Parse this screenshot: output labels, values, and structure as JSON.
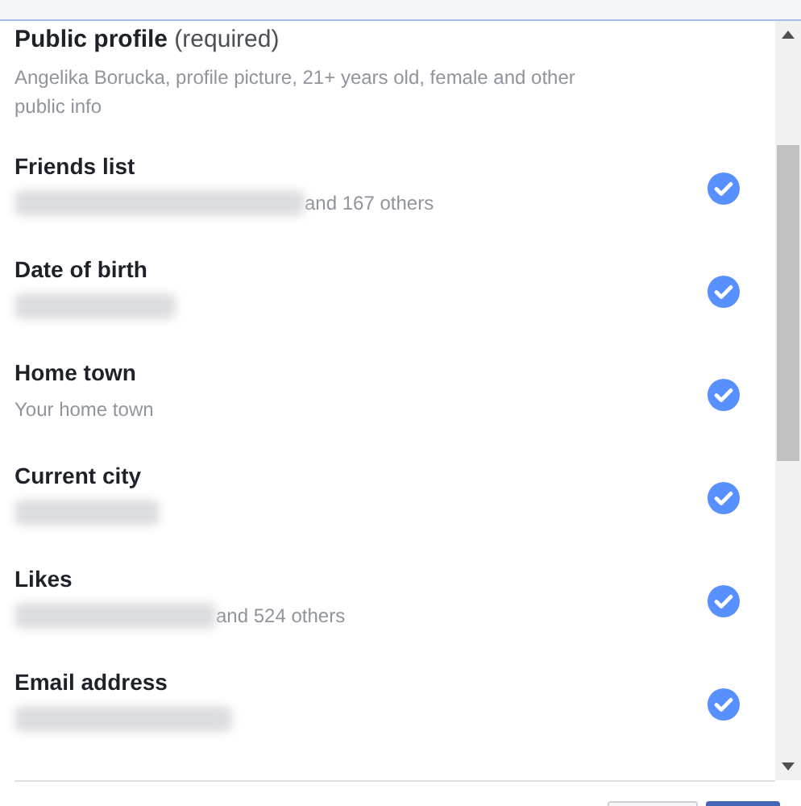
{
  "header": {
    "title": "**Public profile** (required)",
    "detail": "Angelika Borucka, profile picture, 21+ years old, female and other public info"
  },
  "permissions": [
    {
      "label": "Friends list",
      "redacted": true,
      "detail": "and 167 others",
      "checked": true
    },
    {
      "label": "Date of birth",
      "redacted": true,
      "checked": true
    },
    {
      "label": "Home town",
      "redacted": false,
      "detail": "Your home town",
      "checked": true
    },
    {
      "label": "Current city",
      "redacted": true,
      "checked": true
    },
    {
      "label": "Likes",
      "redacted": true,
      "detail": "and 524 others",
      "checked": true
    },
    {
      "label": "Email address",
      "redacted": true,
      "checked": true
    }
  ]
}
